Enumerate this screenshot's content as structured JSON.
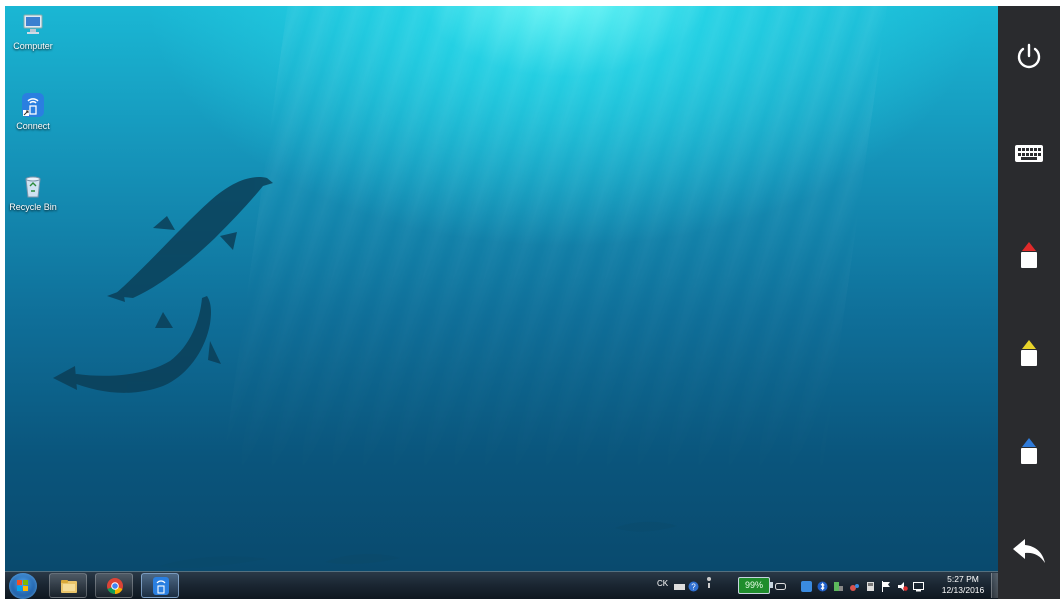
{
  "desktop": {
    "icons": [
      {
        "name": "computer-icon",
        "label": "Computer"
      },
      {
        "name": "connect-icon",
        "label": "Connect"
      },
      {
        "name": "recycle-bin-icon",
        "label": "Recycle Bin"
      }
    ]
  },
  "taskbar": {
    "buttons": [
      {
        "name": "file-explorer-icon"
      },
      {
        "name": "chrome-icon"
      },
      {
        "name": "connect-app-icon"
      }
    ],
    "tray": {
      "language": "CK",
      "battery_percent": "99%",
      "time": "5:27 PM",
      "date": "12/13/2016"
    }
  },
  "side_panel": {
    "buttons": [
      {
        "name": "power-icon"
      },
      {
        "name": "keyboard-icon"
      },
      {
        "name": "red-marker-icon",
        "color": "#e02a2a"
      },
      {
        "name": "yellow-marker-icon",
        "color": "#e8d42a"
      },
      {
        "name": "blue-marker-icon",
        "color": "#2f7ad8"
      },
      {
        "name": "back-arrow-icon"
      }
    ]
  },
  "colors": {
    "panel_bg": "#2a2b2e",
    "taskbar_bg": "#1b2733",
    "water_light": "#1ab7d4",
    "water_dark": "#094a6e"
  }
}
